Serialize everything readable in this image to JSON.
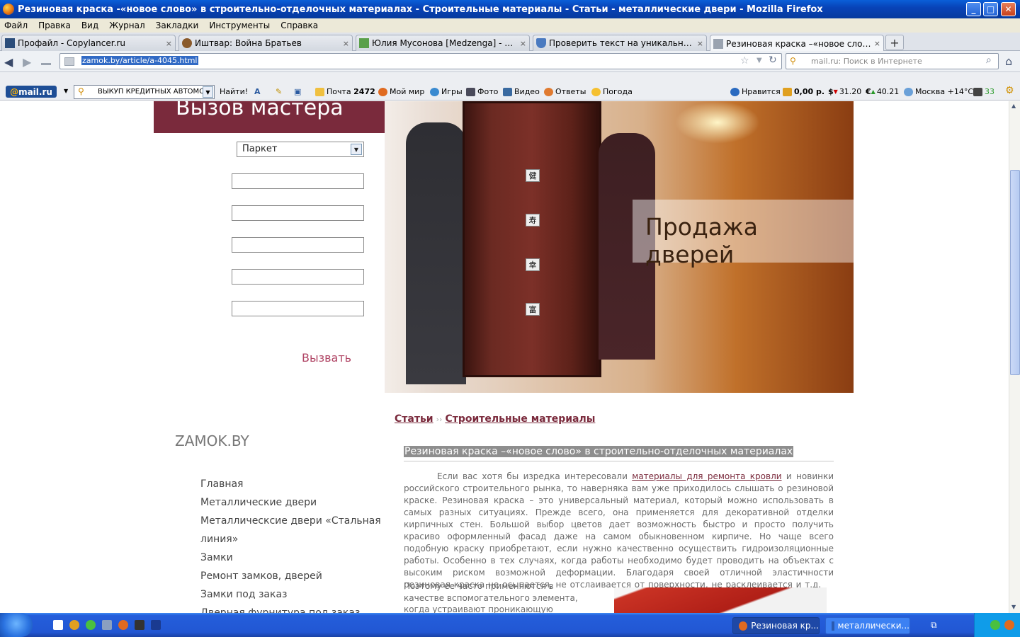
{
  "window": {
    "title": "Резиновая краска -«новое слово» в строительно-отделочных материалах - Строительные материалы - Статьи - металлические двери - Mozilla Firefox",
    "minimize": "_",
    "maximize": "□",
    "close": "✕"
  },
  "menu": [
    "Файл",
    "Правка",
    "Вид",
    "Журнал",
    "Закладки",
    "Инструменты",
    "Справка"
  ],
  "tabs": [
    {
      "label": "Профайл - Copylancer.ru",
      "icon": "copylancer-icon"
    },
    {
      "label": "Иштвар: Война Братьев",
      "icon": "game-icon"
    },
    {
      "label": "Юлия Мусонова [Medzenga] - Портфолио",
      "icon": "portfolio-icon"
    },
    {
      "label": "Проверить текст на уникальность онл...",
      "icon": "shield-icon"
    },
    {
      "label": "Резиновая краска –«новое слово» в ст...",
      "icon": "site-icon"
    }
  ],
  "tab_close": "×",
  "new_tab": "+",
  "nav": {
    "url": "zamok.by/article/a-4045.html",
    "search_placeholder": "mail.ru: Поиск в Интернете"
  },
  "mail_toolbar": {
    "logo_at": "@",
    "logo_text": "mail.ru",
    "search_value": "ВЫКУП КРЕДИТНЫХ АВТОМО",
    "find": "Найти!",
    "mail_label": "Почта",
    "mail_count": "2472",
    "myworld": "Мой мир",
    "games": "Игры",
    "photo": "Фото",
    "video": "Видео",
    "answers": "Ответы",
    "weather": "Погода",
    "likes": "Нравится",
    "balance": "0,00 р.",
    "usd": "31.20",
    "eur": "40.21",
    "city": "Москва +14°C",
    "traffic": "33"
  },
  "form": {
    "title": "Вызов мастера",
    "select_value": "Паркет",
    "submit": "Вызвать"
  },
  "banner": {
    "text": "Продажа дверей"
  },
  "sidebar": {
    "site_name": "ZAMOK.BY",
    "items": [
      "Главная",
      "Металлические двери",
      "Металлическсие двери «Стальная",
      "линия»",
      "Замки",
      "Ремонт замков, дверей",
      "Замки под заказ",
      "Дверная фурнитура под заказ"
    ]
  },
  "breadcrumbs": {
    "first": "Статьи",
    "separator": "››",
    "second": "Строительные материалы"
  },
  "article": {
    "title": "Резиновая краска –«новое слово» в строительно-отделочных материалах",
    "p1_start": "Если вас хотя бы изредка интересовали ",
    "p1_link": "материалы для ремонта кровли",
    "p1_rest": " и новинки российского строительного рынка, то наверняка вам уже приходилось слышать о резиновой краске. Резиновая краска – это универсальный материал, который можно использовать в самых разных ситуациях. Прежде всего, она применяется для декоративной отделки кирпичных стен. Большой выбор цветов дает возможность быстро и просто получить красиво оформленный фасад даже на самом обыкновенном кирпиче. Но чаще всего подобную краску приобретают, если нужно качественно осуществить гидроизоляционные работы. Особенно в тех случаях, когда работы необходимо будет проводить на объектах с высоким риском возможной деформации. Благодаря своей отличной эластичности резиновая краска не осыпается, не отслаивается от поверхности, не расклеивается и т.д.",
    "p2": "Поэтому ее часто применяются в качестве вспомогательного элемента, когда устраивают проникающую гидроизоляцию фундаментов и"
  },
  "taskbar": {
    "items": [
      "Резиновая кр...",
      "металлически..."
    ]
  },
  "colors": {
    "accent": "#7a2a3c",
    "link": "#7a2a3c",
    "xp_blue": "#245edb"
  }
}
